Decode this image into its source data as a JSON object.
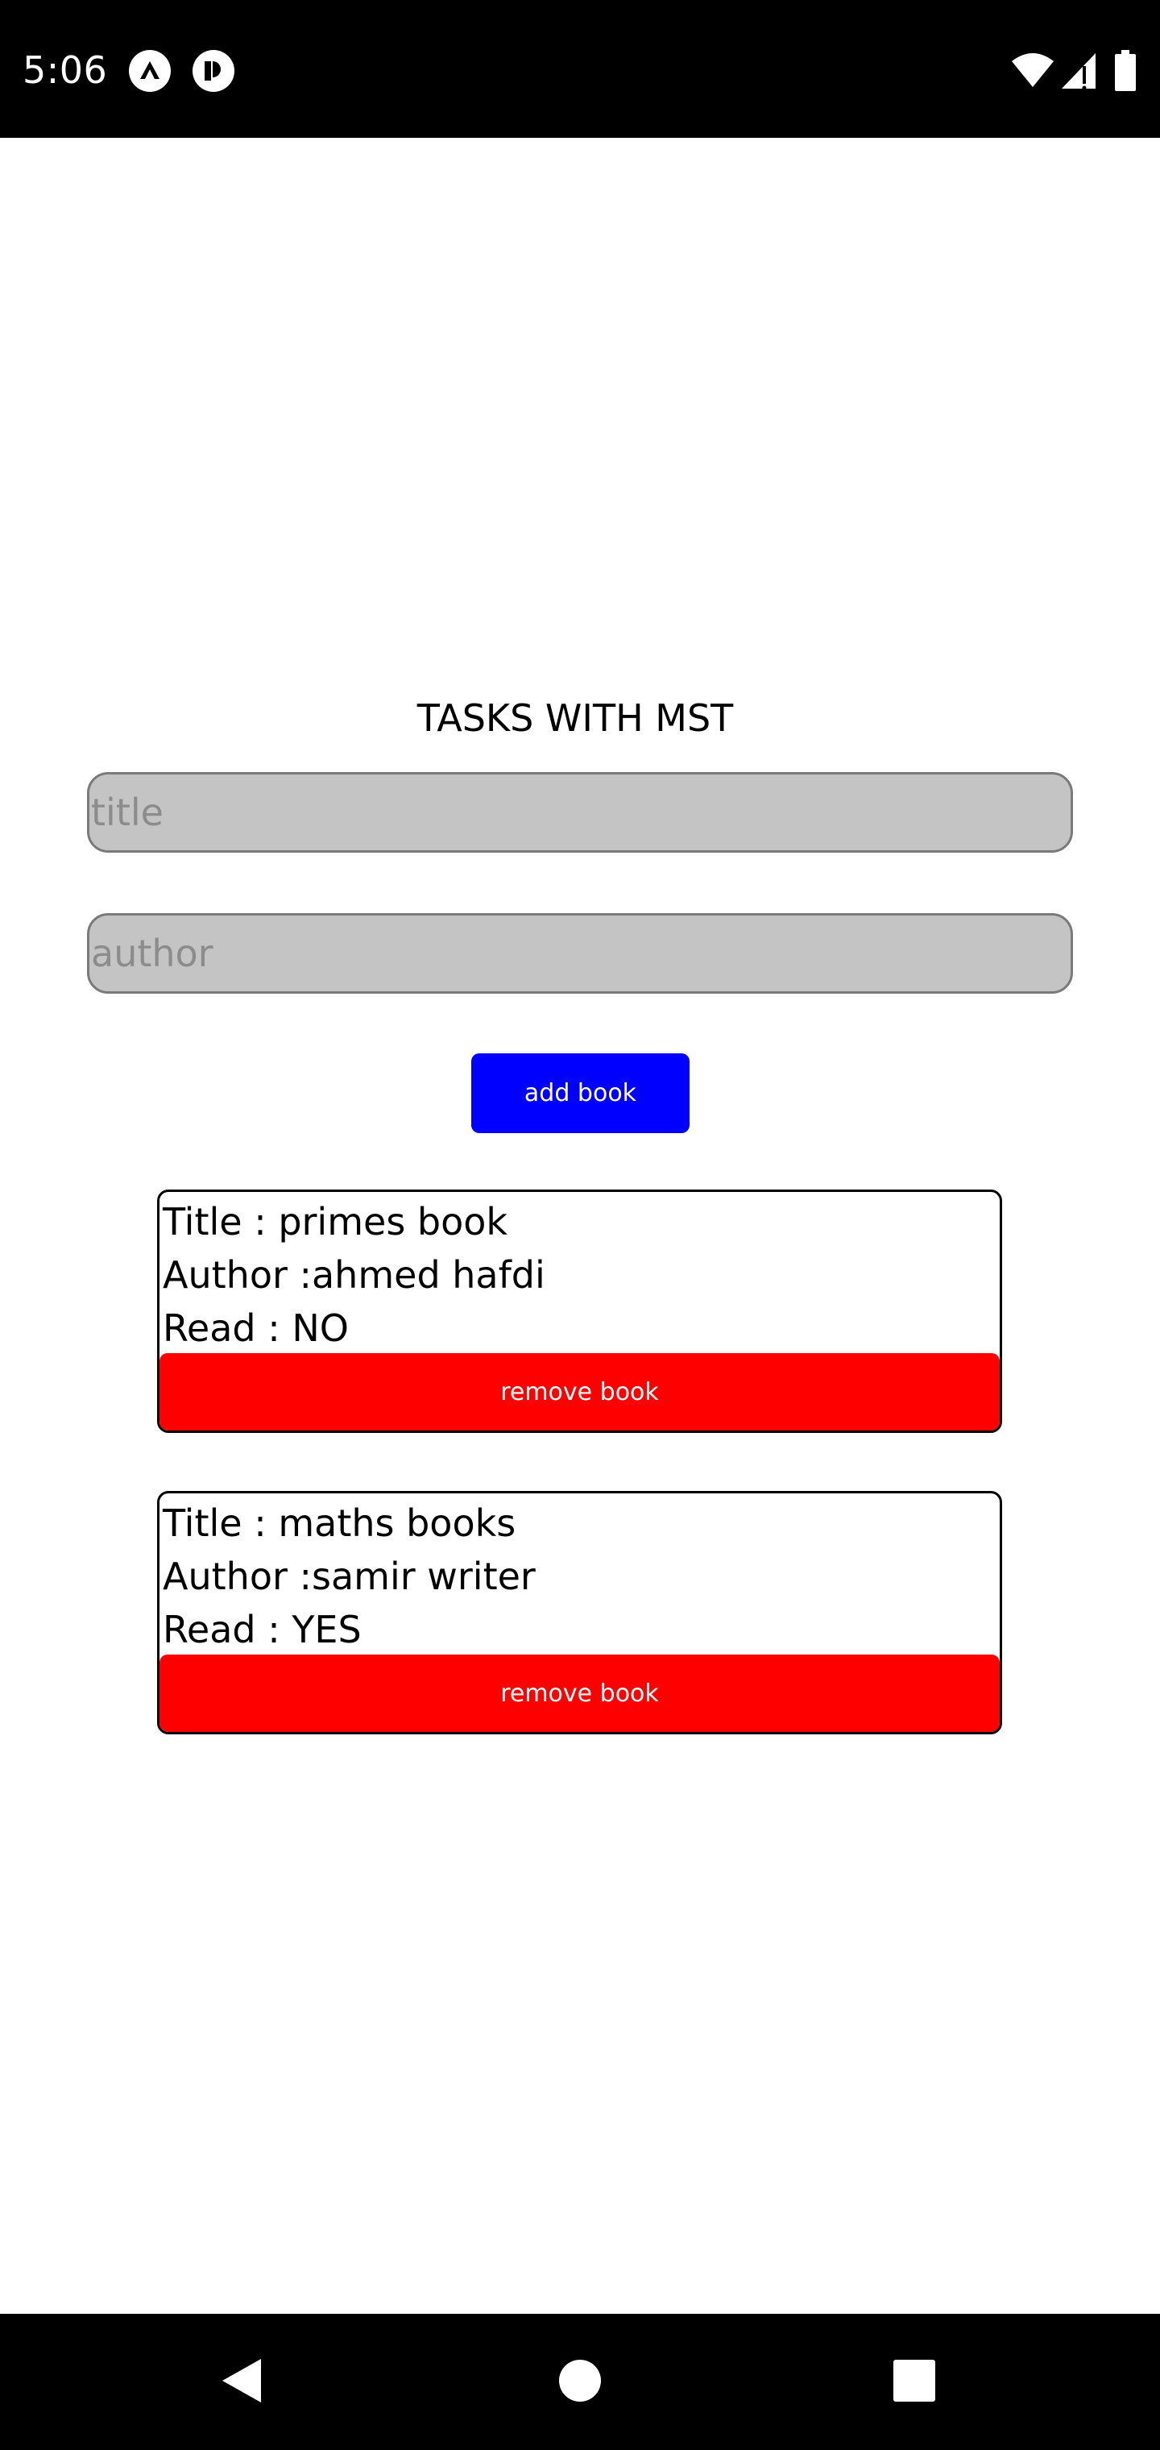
{
  "status_bar": {
    "time": "5:06",
    "icons": [
      "app-a-icon",
      "app-r-icon",
      "wifi-icon",
      "cell-signal-icon",
      "battery-icon"
    ]
  },
  "page": {
    "title": "TASKS WITH MST"
  },
  "form": {
    "title_placeholder": "title",
    "title_value": "",
    "author_placeholder": "author",
    "author_value": "",
    "add_button_label": "add book"
  },
  "books": [
    {
      "title_line": "Title : primes book",
      "author_line": "Author :ahmed hafdi",
      "read_line": "Read : NO",
      "remove_label": "remove book"
    },
    {
      "title_line": "Title : maths books",
      "author_line": "Author :samir writer",
      "read_line": "Read : YES",
      "remove_label": "remove book"
    }
  ],
  "nav_bar": {
    "icons": [
      "back-icon",
      "home-icon",
      "recents-icon"
    ]
  },
  "colors": {
    "add_button": "#0000ff",
    "remove_button": "#ff0000",
    "input_background": "#c4c4c4",
    "bars": "#000000"
  }
}
